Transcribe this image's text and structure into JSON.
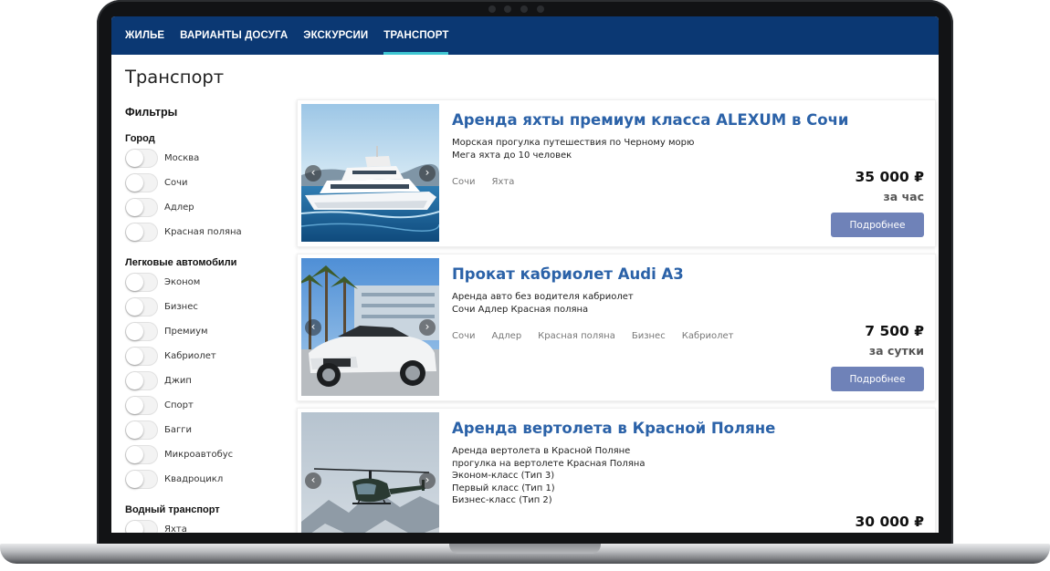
{
  "nav": {
    "items": [
      "ЖИЛЬЕ",
      "ВАРИАНТЫ ДОСУГА",
      "ЭКСКУРСИИ",
      "ТРАНСПОРТ"
    ],
    "active": "ТРАНСПОРТ"
  },
  "page": {
    "title": "Транспорт"
  },
  "filters": {
    "title": "Фильтры",
    "groups": [
      {
        "title": "Город",
        "options": [
          "Москва",
          "Сочи",
          "Адлер",
          "Красная поляна"
        ]
      },
      {
        "title": "Легковые автомобили",
        "options": [
          "Эконом",
          "Бизнес",
          "Премиум",
          "Кабриолет",
          "Джип",
          "Спорт",
          "Багги",
          "Микроавтобус",
          "Квадроцикл"
        ]
      },
      {
        "title": "Водный транспорт",
        "options": [
          "Яхта"
        ]
      }
    ]
  },
  "listings": [
    {
      "title": "Аренда яхты премиум класса ALEXUM в Сочи",
      "description": [
        "Морская прогулка путешествия по Черному морю",
        "Мега яхта до 10 человек"
      ],
      "tags": [
        "Сочи",
        "Яхта"
      ],
      "price": "35 000 ₽",
      "period": "за час",
      "button": "Подробнее"
    },
    {
      "title": "Прокат кабриолет Audi A3",
      "description": [
        "Аренда авто без водителя кабриолет",
        "Сочи Адлер Красная поляна"
      ],
      "tags": [
        "Сочи",
        "Адлер",
        "Красная поляна",
        "Бизнес",
        "Кабриолет"
      ],
      "price": "7 500 ₽",
      "period": "за сутки",
      "button": "Подробнее"
    },
    {
      "title": "Аренда вертолета в Красной Поляне",
      "description": [
        "Аренда вертолета в Красной Поляне",
        "прогулка на вертолете Красная Поляна",
        "Эконом-класс (Тип 3)",
        "Первый класс (Тип 1)",
        "Бизнес-класс (Тип 2)"
      ],
      "tags": [],
      "price": "30 000 ₽"
    }
  ],
  "colors": {
    "nav_bg": "#0b3873",
    "nav_active_underline": "#3ec6d2",
    "title_link": "#2b62a8",
    "button_bg": "#6f82b8"
  },
  "icons": {
    "carousel_prev": "chevron-left-icon",
    "carousel_next": "chevron-right-icon"
  }
}
